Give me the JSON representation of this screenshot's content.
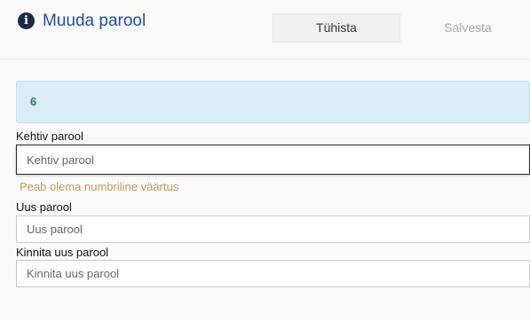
{
  "dialog": {
    "title": "Muuda parool",
    "cancel_label": "Tühista",
    "save_label": "Salvesta"
  },
  "alert": {
    "text": "6"
  },
  "form": {
    "current_password": {
      "label": "Kehtiv parool",
      "placeholder": "Kehtiv parool",
      "value": "",
      "error": "Peab olema numbriline väärtus"
    },
    "new_password": {
      "label": "Uus parool",
      "placeholder": "Uus parool",
      "value": ""
    },
    "confirm_password": {
      "label": "Kinnita uus parool",
      "placeholder": "Kinnita uus parool",
      "value": ""
    }
  },
  "colors": {
    "title": "#1b4f9c",
    "alert_bg": "#d9edf7",
    "alert_text": "#31708f",
    "error_text": "#c59a5a",
    "disabled_text": "#a8a8a8"
  },
  "icons": {
    "title_icon": "info-icon"
  }
}
